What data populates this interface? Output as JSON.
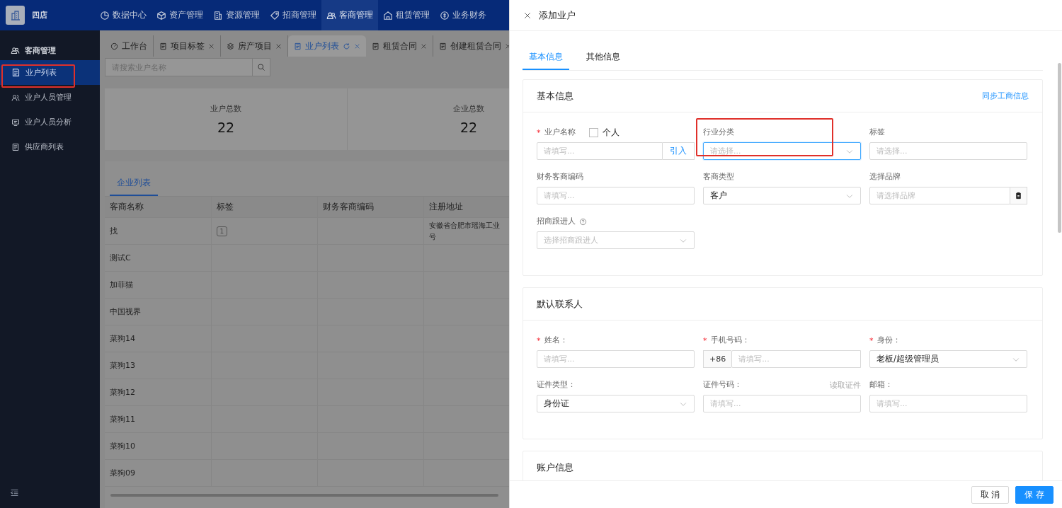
{
  "app": {
    "name": "四店"
  },
  "top_nav": [
    {
      "label": "数据中心",
      "selected": false
    },
    {
      "label": "资产管理",
      "selected": false
    },
    {
      "label": "资源管理",
      "selected": false
    },
    {
      "label": "招商管理",
      "selected": false
    },
    {
      "label": "客商管理",
      "selected": true
    },
    {
      "label": "租赁管理",
      "selected": false
    },
    {
      "label": "业务财务",
      "selected": false
    }
  ],
  "sidebar": {
    "title": "客商管理",
    "items": [
      {
        "label": "业户列表",
        "selected": true,
        "highlighted": true
      },
      {
        "label": "业户人员管理",
        "selected": false,
        "highlighted": false
      },
      {
        "label": "业户人员分析",
        "selected": false,
        "highlighted": false
      },
      {
        "label": "供应商列表",
        "selected": false,
        "highlighted": false
      }
    ]
  },
  "page_tabs": [
    {
      "label": "工作台",
      "selected": false,
      "closable": false
    },
    {
      "label": "项目标签",
      "selected": false,
      "closable": true
    },
    {
      "label": "房产项目",
      "selected": false,
      "closable": true
    },
    {
      "label": "业户列表",
      "selected": true,
      "closable": true
    },
    {
      "label": "租赁合同",
      "selected": false,
      "closable": true
    },
    {
      "label": "创建租赁合同",
      "selected": false,
      "closable": true
    }
  ],
  "search": {
    "placeholder": "请搜索业户名称"
  },
  "stats": [
    {
      "label": "业户总数",
      "value": "22"
    },
    {
      "label": "企业总数",
      "value": "22"
    }
  ],
  "list_tabs": [
    {
      "label": "企业列表",
      "selected": true
    }
  ],
  "table": {
    "columns": [
      "客商名称",
      "标签",
      "财务客商编码",
      "注册地址"
    ],
    "rows": [
      [
        "找",
        "1",
        "",
        [
          "安徽省合肥市瑶海工业",
          "号"
        ]
      ],
      [
        "测试C",
        "",
        "",
        ""
      ],
      [
        "加菲猫",
        "",
        "",
        ""
      ],
      [
        "中国视界",
        "",
        "",
        ""
      ],
      [
        "菜狗14",
        "",
        "",
        ""
      ],
      [
        "菜狗13",
        "",
        "",
        ""
      ],
      [
        "菜狗12",
        "",
        "",
        ""
      ],
      [
        "菜狗11",
        "",
        "",
        ""
      ],
      [
        "菜狗10",
        "",
        "",
        ""
      ],
      [
        "菜狗09",
        "",
        "",
        ""
      ]
    ]
  },
  "drawer": {
    "title": "添加业户",
    "tabs": [
      {
        "label": "基本信息",
        "selected": true
      },
      {
        "label": "其他信息",
        "selected": false
      }
    ],
    "sections": [
      {
        "title": "基本信息",
        "action": "同步工商信息",
        "fields": [
          {
            "kind": "input-addon",
            "label": "业户名称",
            "required_mark": "*",
            "checkbox": {
              "label": "个人",
              "checked": false
            },
            "placeholder": "请填写...",
            "addon": "引入"
          },
          {
            "kind": "select",
            "label": "行业分类",
            "placeholder": "请选择...",
            "focused": true,
            "highlighted": true
          },
          {
            "kind": "input",
            "label": "标签",
            "placeholder": "请选择..."
          },
          {
            "kind": "input",
            "label": "财务客商编码",
            "placeholder": "请填写..."
          },
          {
            "kind": "select",
            "label": "客商类型",
            "value": "客户"
          },
          {
            "kind": "select-button",
            "label": "选择品牌",
            "placeholder": "请选择品牌"
          },
          {
            "kind": "select",
            "label": "招商跟进人",
            "help": true,
            "placeholder": "选择招商跟进人"
          }
        ]
      },
      {
        "title": "默认联系人",
        "fields": [
          {
            "kind": "input",
            "label": "姓名：",
            "required_mark": "*",
            "placeholder": "请填写..."
          },
          {
            "kind": "prefix-input",
            "label": "手机号码：",
            "required_mark": "*",
            "prefix": "+86",
            "placeholder": "请填写..."
          },
          {
            "kind": "select",
            "label": "身份：",
            "required_mark": "*",
            "value": "老板/超级管理员"
          },
          {
            "kind": "select",
            "label": "证件类型：",
            "value": "身份证"
          },
          {
            "kind": "input",
            "label": "证件号码：",
            "link": "读取证件",
            "placeholder": "请填写..."
          },
          {
            "kind": "input",
            "label": "邮箱：",
            "placeholder": "请填写..."
          }
        ]
      },
      {
        "title": "账户信息"
      }
    ]
  },
  "footer_buttons": [
    {
      "label": "取 消",
      "kind": "default"
    },
    {
      "label": "保 存",
      "kind": "primary"
    }
  ]
}
